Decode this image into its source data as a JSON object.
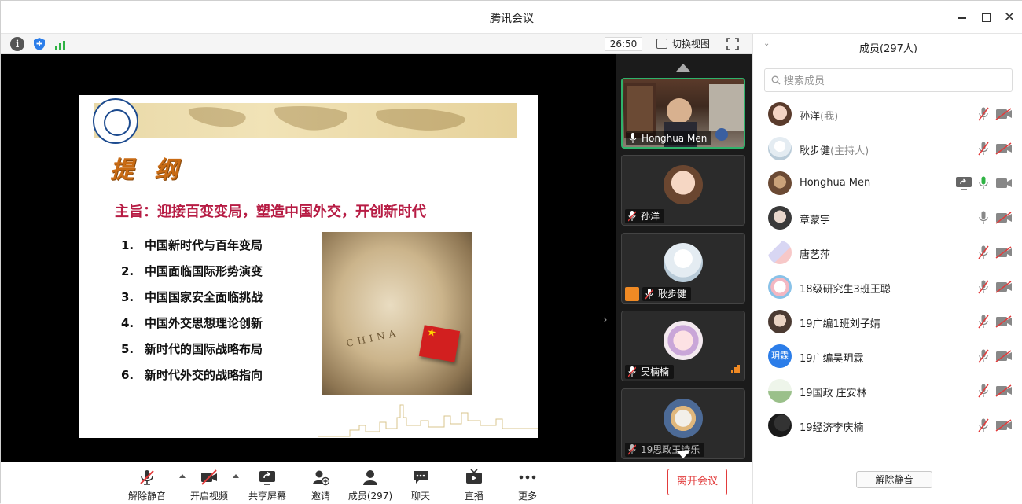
{
  "window": {
    "title": "腾讯会议"
  },
  "top_toolbar": {
    "timer": "26:50",
    "switch_view_label": "切换视图"
  },
  "slide": {
    "heading": "提 纲",
    "theme": "主旨：迎接百变变局，塑造中国外交，开创新时代",
    "outline": [
      {
        "num": "1.",
        "text": "中国新时代与百年变局"
      },
      {
        "num": "2.",
        "text": "中国面临国际形势演变"
      },
      {
        "num": "3.",
        "text": "中国国家安全面临挑战"
      },
      {
        "num": "4.",
        "text": "中国外交思想理论创新"
      },
      {
        "num": "5.",
        "text": "新时代的国际战略布局"
      },
      {
        "num": "6.",
        "text": "新时代外交的战略指向"
      }
    ],
    "map_label": "CHINA",
    "banner_colors": {
      "accent": "#c96b14",
      "theme": "#b71c44"
    }
  },
  "video_strip": {
    "tiles": [
      {
        "name": "Honghua Men"
      },
      {
        "name": "孙洋"
      },
      {
        "name": "耿步健"
      },
      {
        "name": "吴楠楠"
      },
      {
        "name": "19思政王诗乐"
      }
    ]
  },
  "bottom_toolbar": {
    "unmute_label": "解除静音",
    "video_label": "开启视频",
    "share_label": "共享屏幕",
    "invite_label": "邀请",
    "members_label": "成员(297)",
    "chat_label": "聊天",
    "live_label": "直播",
    "more_label": "更多",
    "leave_label": "离开会议"
  },
  "members_panel": {
    "title": "成员(297人)",
    "search_placeholder": "搜索成员",
    "unmute_all_label": "解除静音",
    "members": [
      {
        "name": "孙洋",
        "role": "(我)",
        "mic": "muted",
        "camera": "off"
      },
      {
        "name": "耿步健",
        "role": "(主持人)",
        "mic": "muted",
        "camera": "off"
      },
      {
        "name": "Honghua Men",
        "role": "",
        "mic": "active",
        "camera": "on",
        "sharing": true
      },
      {
        "name": "章蒙宇",
        "role": "",
        "mic": "on",
        "camera": "off"
      },
      {
        "name": "唐艺萍",
        "role": "",
        "mic": "muted",
        "camera": "off"
      },
      {
        "name": "18级研究生3班王聪",
        "role": "",
        "mic": "muted",
        "camera": "off"
      },
      {
        "name": "19广编1班刘子婧",
        "role": "",
        "mic": "muted",
        "camera": "off"
      },
      {
        "name": "19广编吴玥霖",
        "role": "",
        "mic": "muted",
        "camera": "off",
        "avatar_text": "玥霖"
      },
      {
        "name": "19国政 庄安林",
        "role": "",
        "mic": "muted",
        "camera": "off"
      },
      {
        "name": "19经济李庆楠",
        "role": "",
        "mic": "muted",
        "camera": "off"
      }
    ]
  },
  "colors": {
    "active_green": "#2fb344",
    "muted_red": "#e23b3b",
    "accent_orange": "#f08a24"
  }
}
